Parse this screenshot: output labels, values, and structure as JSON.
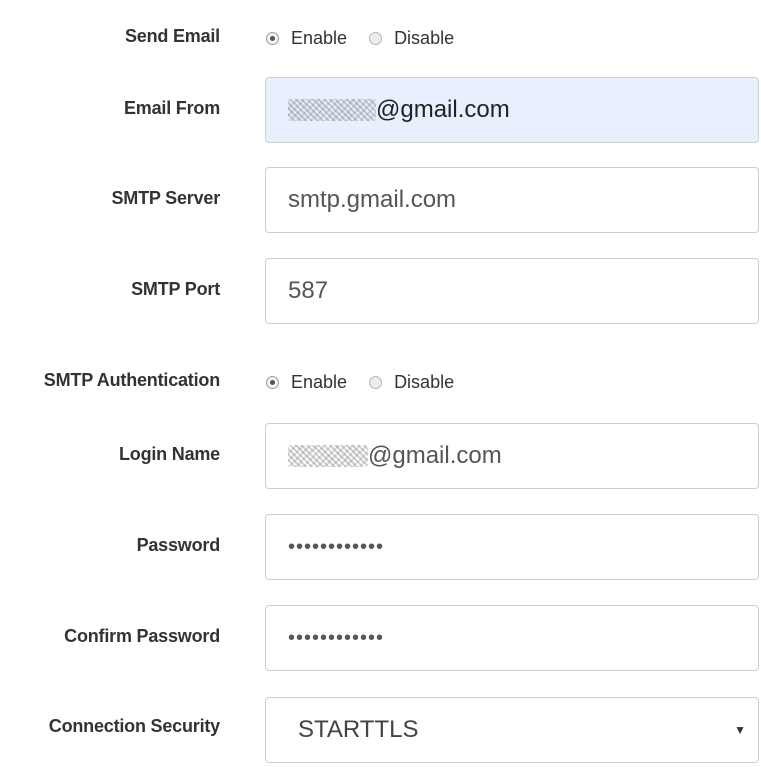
{
  "send_email": {
    "label": "Send Email",
    "options": [
      "Enable",
      "Disable"
    ],
    "selected": "Enable"
  },
  "email_from": {
    "label": "Email From",
    "value_suffix": "@gmail.com"
  },
  "smtp_server": {
    "label": "SMTP Server",
    "value": "smtp.gmail.com"
  },
  "smtp_port": {
    "label": "SMTP Port",
    "value": "587"
  },
  "smtp_auth": {
    "label": "SMTP Authentication",
    "options": [
      "Enable",
      "Disable"
    ],
    "selected": "Enable"
  },
  "login_name": {
    "label": "Login Name",
    "value_suffix": "@gmail.com"
  },
  "password": {
    "label": "Password",
    "masked": "••••••••••••"
  },
  "confirm_password": {
    "label": "Confirm Password",
    "masked": "••••••••••••"
  },
  "connection_security": {
    "label": "Connection Security",
    "selected": "STARTTLS"
  }
}
